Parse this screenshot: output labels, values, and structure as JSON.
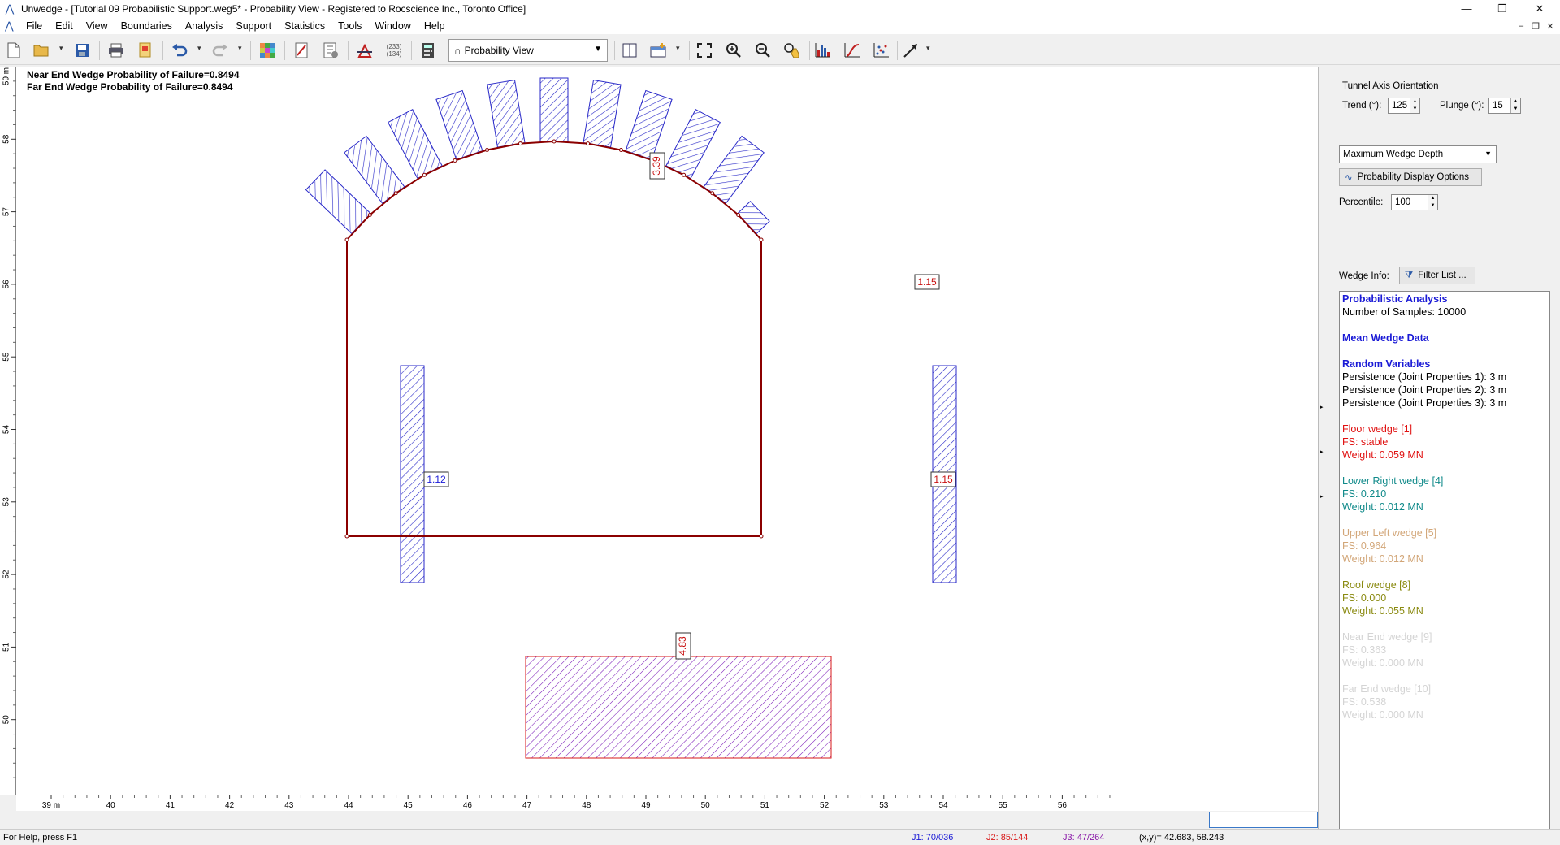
{
  "window": {
    "title": "Unwedge - [Tutorial 09 Probabilistic Support.weg5* - Probability View - Registered to Rocscience Inc., Toronto Office]",
    "controls": [
      "—",
      "❐",
      "✕"
    ],
    "mdi_controls": [
      "–",
      "❐",
      "✕"
    ]
  },
  "menu": [
    "File",
    "Edit",
    "View",
    "Boundaries",
    "Analysis",
    "Support",
    "Statistics",
    "Tools",
    "Window",
    "Help"
  ],
  "toolbar": {
    "view_selector": "Probability View",
    "icons": [
      "new-file-icon",
      "open-folder-icon",
      "save-icon",
      "print-icon",
      "export-icon",
      "undo-icon",
      "redo-icon",
      "color-grid-icon",
      "edit-icon",
      "properties-icon",
      "compute-icon",
      "statistics-icon",
      "calculator-icon",
      "split-view-icon",
      "add-view-icon",
      "zoom-all-icon",
      "zoom-in-icon",
      "zoom-out-icon",
      "pan-icon",
      "histogram-icon",
      "cumulative-icon",
      "scatter-icon",
      "arrow-tool-icon"
    ],
    "stats_label": "(233)\n(134)"
  },
  "canvas": {
    "probability_lines": [
      "Near End Wedge Probability of Failure=0.8494",
      "Far End Wedge Probability of Failure=0.8494"
    ],
    "x_ticks": [
      "39 m",
      "40",
      "41",
      "42",
      "43",
      "44",
      "45",
      "46",
      "47",
      "48",
      "49",
      "50",
      "51",
      "52",
      "53",
      "54",
      "55",
      "56"
    ],
    "y_ticks": [
      "59 m",
      "58",
      "57",
      "56",
      "55",
      "54",
      "53",
      "52",
      "51",
      "50"
    ],
    "wedge_labels": {
      "roof": "3.39",
      "upper_right": "1.15",
      "left": "1.12",
      "right": "1.15",
      "floor": "4.83"
    },
    "colors": {
      "tunnel": "#8b0000",
      "hatch_blue": "#2828c8",
      "hatch_red": "#d81818",
      "label_blue": "#1a1ad6",
      "label_red": "#c81010"
    }
  },
  "right_panel": {
    "orientation_title": "Tunnel Axis Orientation",
    "trend_label": "Trend (°):",
    "trend_value": "125",
    "plunge_label": "Plunge (°):",
    "plunge_value": "15",
    "display_select": "Maximum Wedge Depth",
    "prob_options_button": "Probability Display Options",
    "percentile_label": "Percentile:",
    "percentile_value": "100",
    "wedge_info_label": "Wedge Info:",
    "filter_button": "Filter List ..."
  },
  "wedge_info": {
    "heading": "Probabilistic Analysis",
    "samples": "Number of Samples: 10000",
    "mean_heading": "Mean Wedge Data",
    "random_heading": "Random Variables",
    "random_vars": [
      "Persistence (Joint Properties 1): 3 m",
      "Persistence (Joint Properties 2): 3 m",
      "Persistence (Joint Properties 3): 3 m"
    ],
    "wedges": [
      {
        "name": "Floor wedge [1]",
        "fs": "FS: stable",
        "weight": "Weight: 0.059 MN",
        "color": "#e01010"
      },
      {
        "name": "Lower Right wedge [4]",
        "fs": "FS: 0.210",
        "weight": "Weight: 0.012 MN",
        "color": "#108a8a"
      },
      {
        "name": "Upper Left wedge [5]",
        "fs": "FS: 0.964",
        "weight": "Weight: 0.012 MN",
        "color": "#d2a678"
      },
      {
        "name": "Roof wedge [8]",
        "fs": "FS: 0.000",
        "weight": "Weight: 0.055 MN",
        "color": "#8a8a10"
      },
      {
        "name": "Near End wedge [9]",
        "fs": "FS: 0.363",
        "weight": "Weight: 0.000 MN",
        "color": "#d4d4d4"
      },
      {
        "name": "Far End wedge [10]",
        "fs": "FS: 0.538",
        "weight": "Weight: 0.000 MN",
        "color": "#d4d4d4"
      }
    ]
  },
  "status": {
    "help": "For Help, press F1",
    "j1": "J1: 70/036",
    "j2": "J2: 85/144",
    "j3": "J3: 47/264",
    "coords": "(x,y)= 42.683, 58.243",
    "j1_color": "#1a1ad6",
    "j2_color": "#d81818",
    "j3_color": "#8a1aa8"
  }
}
